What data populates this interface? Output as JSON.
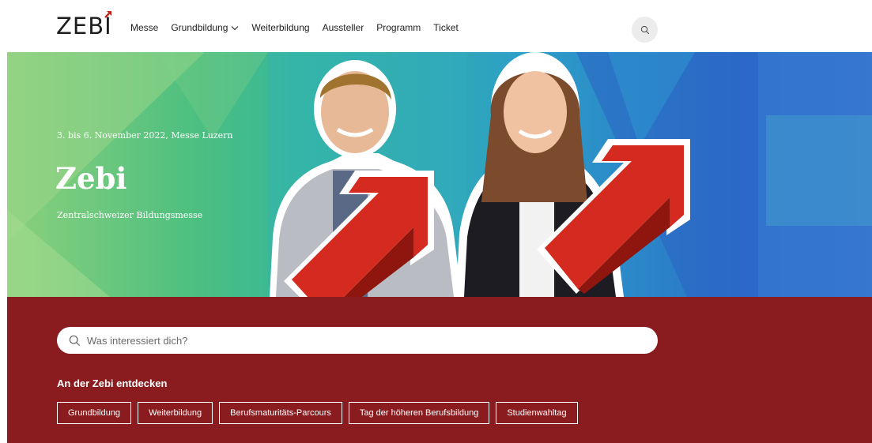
{
  "header": {
    "logo_text": "ZEBI",
    "nav": [
      {
        "label": "Messe"
      },
      {
        "label": "Grundbildung",
        "has_dropdown": true
      },
      {
        "label": "Weiterbildung"
      },
      {
        "label": "Aussteller"
      },
      {
        "label": "Programm"
      },
      {
        "label": "Ticket"
      }
    ],
    "search_icon": "search-icon"
  },
  "hero": {
    "date": "3. bis 6. November 2022, Messe Luzern",
    "title": "Zebi",
    "subtitle": "Zentralschweizer Bildungsmesse"
  },
  "search": {
    "placeholder": "Was interessiert dich?",
    "icon": "search-icon"
  },
  "discover": {
    "heading": "An der Zebi entdecken",
    "chips": [
      {
        "label": "Grundbildung"
      },
      {
        "label": "Weiterbildung"
      },
      {
        "label": "Berufsmaturitäts-Parcours"
      },
      {
        "label": "Tag der höheren Berufsbildung"
      },
      {
        "label": "Studienwahltag"
      }
    ]
  },
  "colors": {
    "brand_red": "#8a1c1f",
    "arrow_red": "#d42a1f",
    "hero_green": "#4cbf80",
    "hero_blue": "#2a70c9"
  }
}
